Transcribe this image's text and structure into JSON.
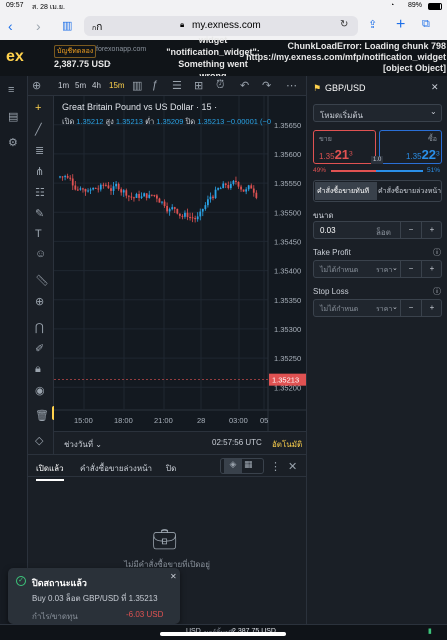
{
  "status": {
    "time": "09:57",
    "date": "ส. 28 เม.ย.",
    "battery": "89%"
  },
  "browser": {
    "aa": "ก",
    "aa_small": "ก",
    "url": "my.exness.com"
  },
  "header": {
    "logo": "ex",
    "account_type": "บัญชีทดลอง",
    "broker": "forexonapp.com",
    "balance": "2,387.75 USD",
    "error_left": "widget\n\"notification_widget\":\nSomething went\nwrong",
    "error_right": "ChunkLoadError: Loading chunk 798\nhttps://my.exness.com/mfp/notification_widget\n[object Object]"
  },
  "toolbar": {
    "tf": [
      "1m",
      "5m",
      "4h",
      "15m"
    ]
  },
  "chart": {
    "title": "Great Britain Pound vs US Dollar · 15 ·",
    "ohlc_o_lbl": "เปิด",
    "ohlc_o": "1.35212",
    "ohlc_h_lbl": "สูง",
    "ohlc_h": "1.35213",
    "ohlc_l_lbl": "ต่ำ",
    "ohlc_l": "1.35209",
    "ohlc_c_lbl": "ปิด",
    "ohlc_c": "1.35213",
    "ohlc_chg": "−0.00001 (−0",
    "price_labels": [
      "1.35650",
      "1.35600",
      "1.35550",
      "1.35500",
      "1.35450",
      "1.35400",
      "1.35350",
      "1.35300",
      "1.35250",
      "1.35200"
    ],
    "current_price": "1.35213",
    "time_labels": [
      "15:00",
      "18:00",
      "21:00",
      "28",
      "03:00",
      "05"
    ],
    "date_range": "ช่วงวันที่",
    "clock": "02:57:56 UTC",
    "auto": "อัตโนมัติ"
  },
  "bottom": {
    "tabs": [
      "เปิดแล้ว",
      "คำสั่งซื้อขายล่วงหน้า",
      "ปิด"
    ],
    "empty": "ไม่มีคำสั่งซื้อขายที่เปิดอยู่"
  },
  "panel": {
    "symbol": "GBP/USD",
    "mode": "โหมดเริ่มต้น",
    "sell_lbl": "ขาย",
    "sell_pre": "1.35",
    "sell_big": "21",
    "sell_sup": "3",
    "buy_lbl": "ซื้อ",
    "buy_pre": "1.35",
    "buy_big": "22",
    "buy_sup": "3",
    "spread": "1.0",
    "pct_sell": "49%",
    "pct_buy": "51%",
    "tab_market": "คำสั่งซื้อขายทันที",
    "tab_pending": "คำสั่งซื้อขายล่วงหน้า",
    "vol_lbl": "ขนาด",
    "vol": "0.03",
    "vol_unit": "ล็อต",
    "tp_lbl": "Take Profit",
    "tp_val": "ไม่ได้กำหนด",
    "tp_unit": "ราคา",
    "sl_lbl": "Stop Loss",
    "sl_val": "ไม่ได้กำหนด",
    "sl_unit": "ราคา"
  },
  "toast": {
    "title": "ปิดสถานะแล้ว",
    "text": "Buy 0.03 ล็อต GBP/USD ที่ 1.35213",
    "pl_lbl": "กำไร/ขาดทุน",
    "pl": "-6.03 USD"
  },
  "footer": {
    "a": "USD",
    "margin_lbl": "มาร์จิ้นฟรี",
    "margin": "2,387.75 USD"
  },
  "colors": {
    "up": "#2aa3e6",
    "down": "#e05252",
    "accent": "#ffd24d"
  }
}
